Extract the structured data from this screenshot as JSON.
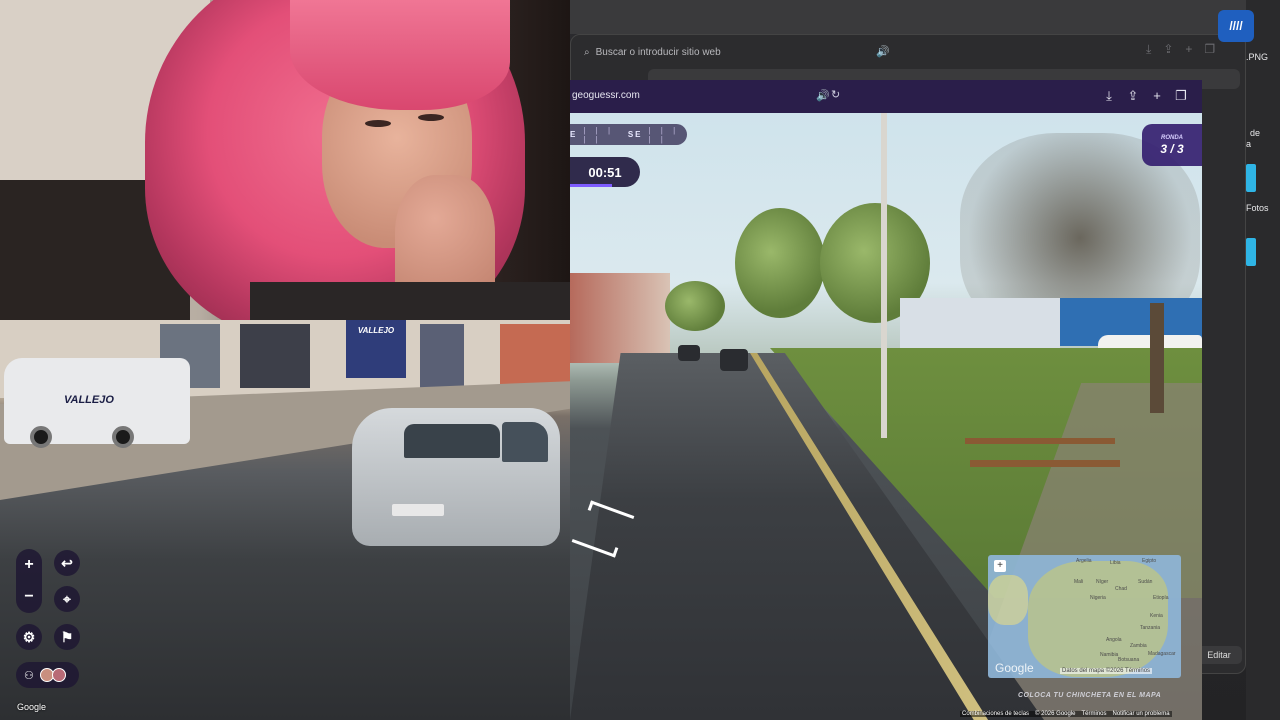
{
  "back_browser": {
    "address_placeholder": "Buscar o introducir sitio web",
    "icons": [
      "download-icon",
      "share-icon",
      "plus-icon",
      "tabs-icon"
    ]
  },
  "right_panel": {
    "file_label": ".PNG",
    "text_de": "de",
    "text_a": "a",
    "text_fotos": "Fotos",
    "edit_button": "Editar"
  },
  "browser": {
    "url": "geoguessr.com",
    "actions": [
      "download-icon",
      "share-icon",
      "new-tab-icon",
      "tabs-icon"
    ]
  },
  "game": {
    "compass": {
      "dir_left": "E",
      "dir_right": "SE",
      "ticks": "| | | | |"
    },
    "timer": "00:51",
    "round_label": "RONDA",
    "round_value": "3 / 3",
    "pin_hint": "COLOCA TU CHINCHETA EN EL MAPA",
    "van_brand": "VALLEJO",
    "shop_sign": "VALLEJO"
  },
  "minimap": {
    "countries": [
      "Argelia",
      "Libia",
      "Egipto",
      "Mali",
      "Níger",
      "Chad",
      "Sudán",
      "Nigeria",
      "Etiopía",
      "Kenia",
      "Tanzania",
      "Angola",
      "Zambia",
      "Namibia",
      "Botsuana",
      "Madagascar"
    ],
    "attribution": "Datos del mapa ©2026",
    "terms": "Términos",
    "google": "Google"
  },
  "footer": {
    "shortcuts": "Combinaciones de teclas",
    "copyright": "© 2026 Google",
    "terms": "Términos",
    "report": "Notificar un problema"
  },
  "watermark": "Google",
  "colors": {
    "accent": "#7d5cff",
    "hud_bg": "#1e163a",
    "round_bg": "#321c6e"
  }
}
